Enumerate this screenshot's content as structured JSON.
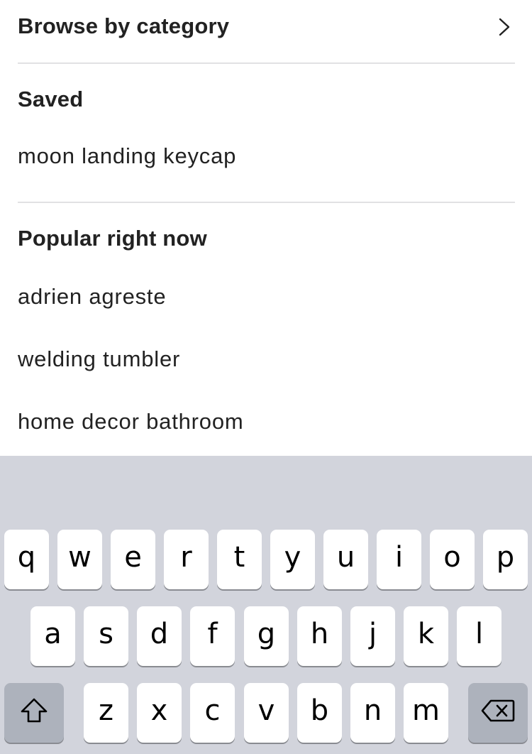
{
  "browse": {
    "label": "Browse by category",
    "icon": "chevron-right-icon"
  },
  "saved": {
    "heading": "Saved",
    "items": [
      "moon landing keycap"
    ]
  },
  "popular": {
    "heading": "Popular right now",
    "items": [
      "adrien agreste",
      "welding tumbler",
      "home decor bathroom"
    ]
  },
  "keyboard": {
    "row1": [
      "q",
      "w",
      "e",
      "r",
      "t",
      "y",
      "u",
      "i",
      "o",
      "p"
    ],
    "row2": [
      "a",
      "s",
      "d",
      "f",
      "g",
      "h",
      "j",
      "k",
      "l"
    ],
    "row3": [
      "z",
      "x",
      "c",
      "v",
      "b",
      "n",
      "m"
    ],
    "shift_icon": "shift-icon",
    "delete_icon": "backspace-icon",
    "colors": {
      "background": "#d2d4dc",
      "key": "#ffffff",
      "function_key": "#adb2bc"
    }
  }
}
